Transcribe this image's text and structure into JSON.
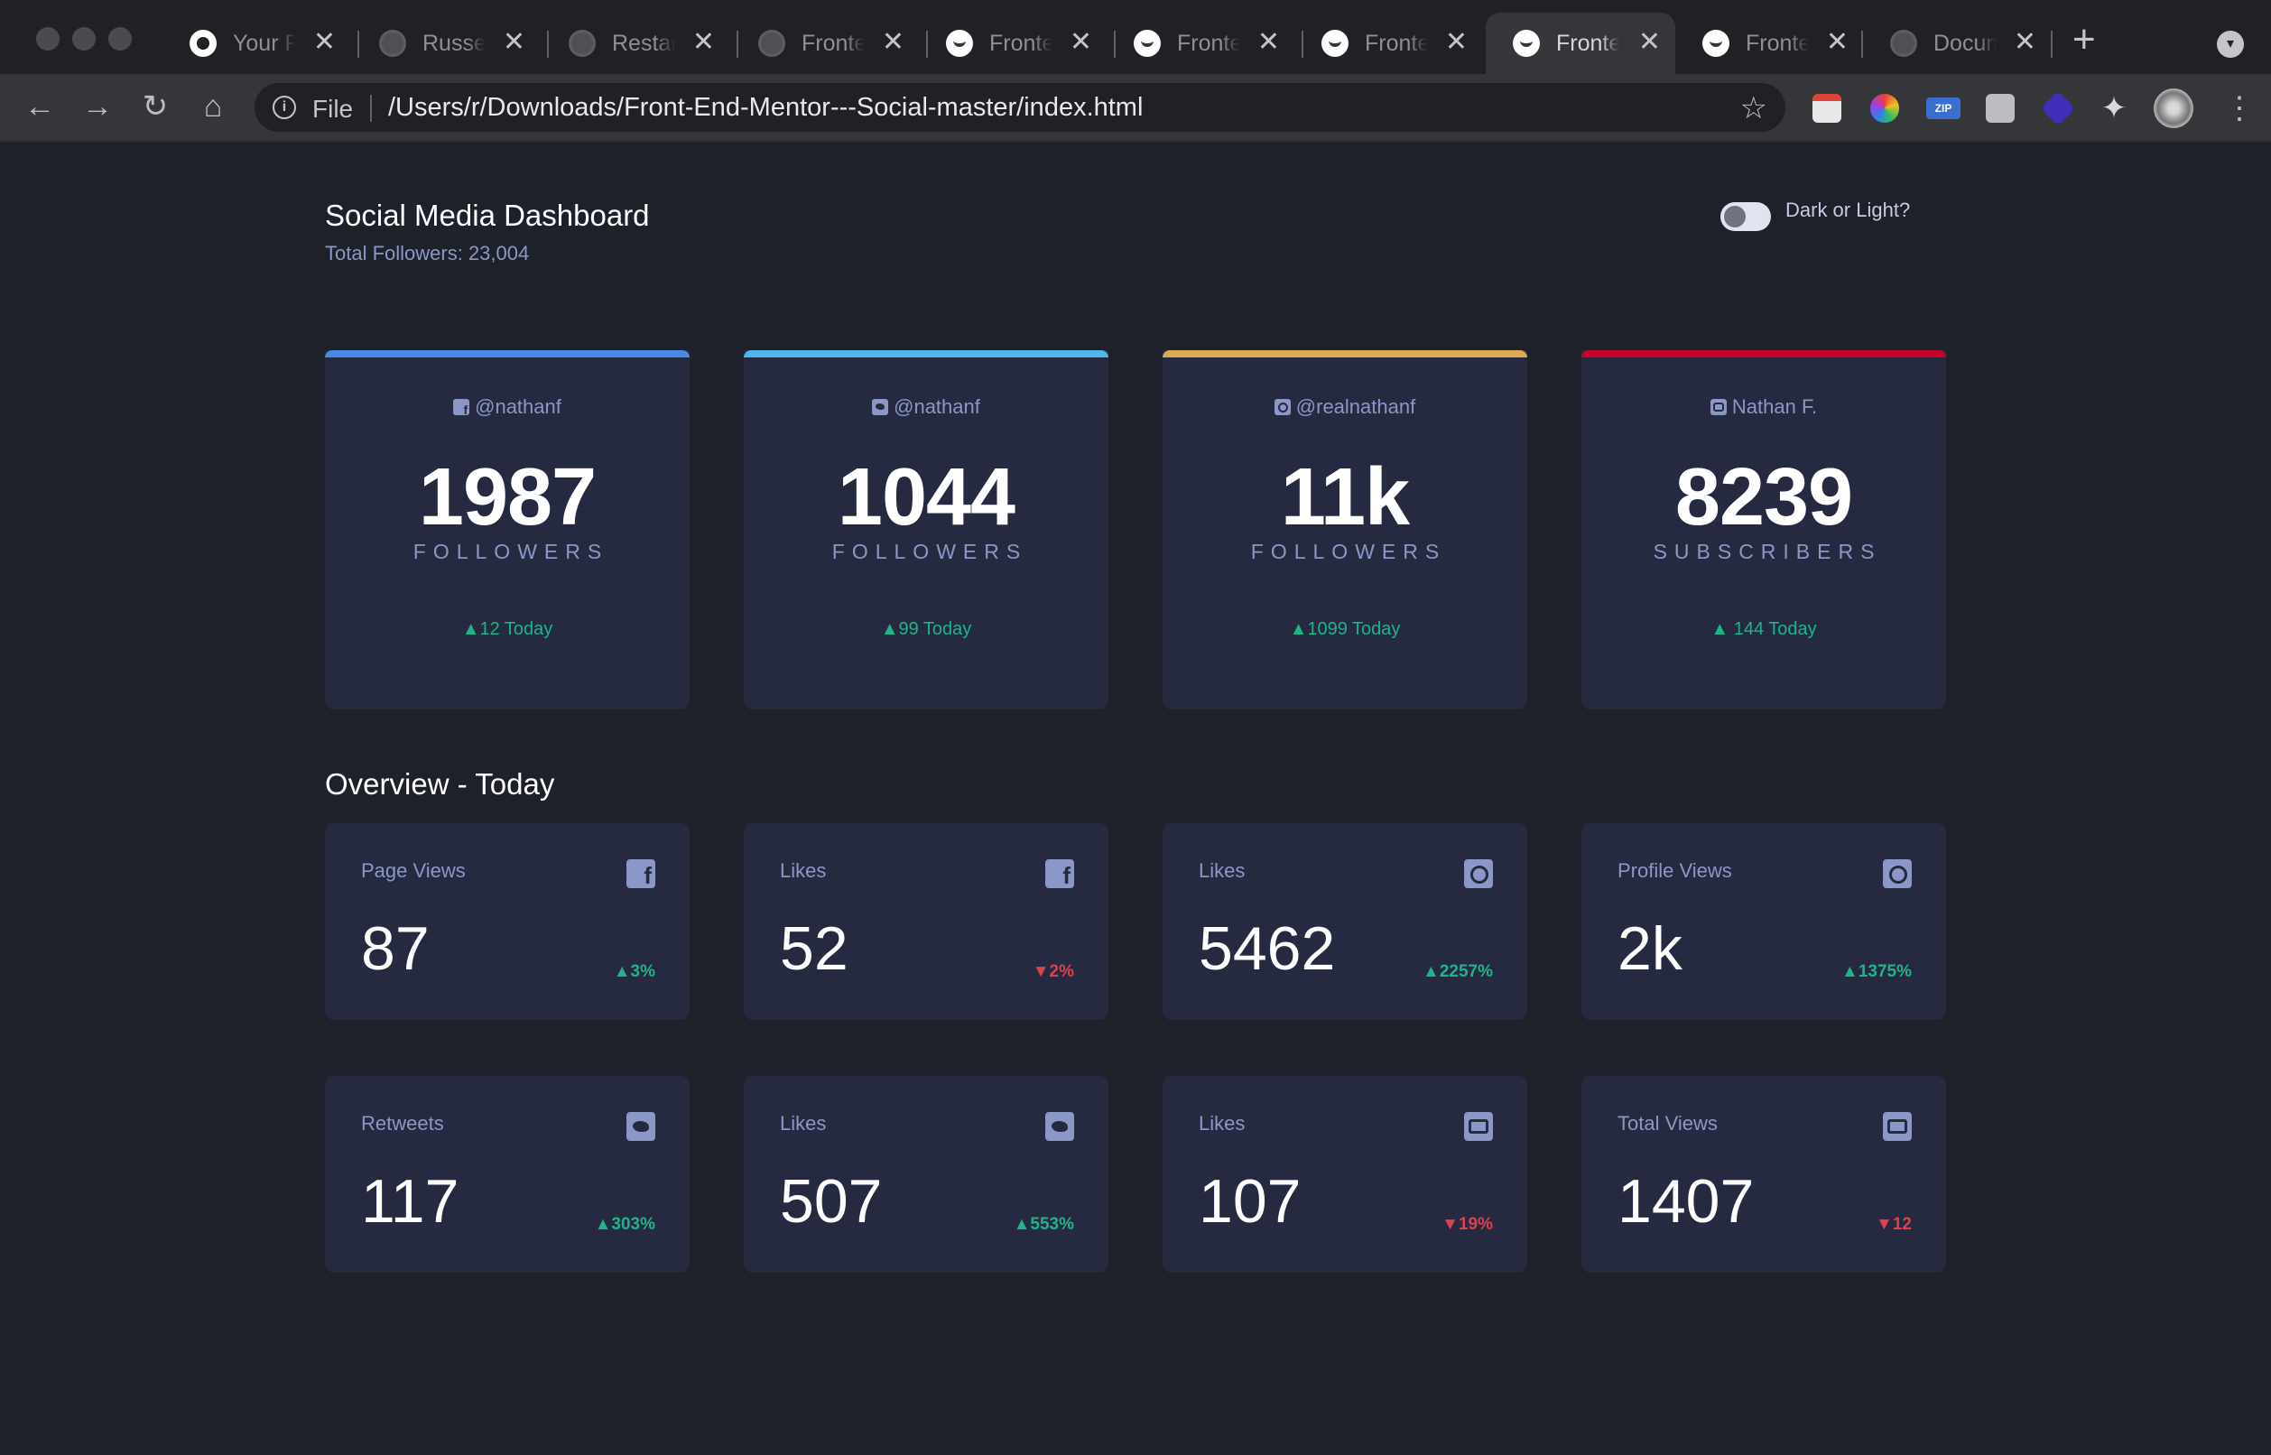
{
  "browser": {
    "tabs": [
      {
        "title": "Your Repositories",
        "icon": "github-icon",
        "active": false
      },
      {
        "title": "Russell",
        "icon": "globe-icon",
        "active": false
      },
      {
        "title": "Restaurant",
        "icon": "globe-icon",
        "active": false
      },
      {
        "title": "Frontend Mentor",
        "icon": "globe-icon",
        "active": false
      },
      {
        "title": "Frontend Mentor",
        "icon": "frontend-mentor-icon",
        "active": false
      },
      {
        "title": "Frontend Mentor",
        "icon": "frontend-mentor-icon",
        "active": false
      },
      {
        "title": "Frontend Mentor",
        "icon": "frontend-mentor-icon",
        "active": false
      },
      {
        "title": "Frontend Mentor",
        "icon": "frontend-mentor-icon",
        "active": true
      },
      {
        "title": "Frontend Mentor",
        "icon": "frontend-mentor-icon",
        "active": false
      },
      {
        "title": "Document",
        "icon": "globe-icon",
        "active": false
      }
    ],
    "tab_close_glyph": "✕",
    "new_tab_glyph": "+",
    "omnibox": {
      "scheme": "File",
      "url": "/Users/r/Downloads/Front-End-Mentor---Social-master/index.html"
    },
    "nav": {
      "back": "←",
      "forward": "→",
      "reload": "↻",
      "home": "⌂",
      "star": "☆",
      "menu": "⋮"
    },
    "extensions": [
      "calendar-extension-icon",
      "color-wheel-extension-icon",
      "zip-extension-icon",
      "camera-extension-icon",
      "layers-extension-icon",
      "puzzle-extension-icon"
    ],
    "extension_texts": {
      "zip": "ZIP",
      "puzzle": "✦"
    }
  },
  "header": {
    "title": "Social Media Dashboard",
    "subtitle": "Total Followers: 23,004",
    "toggle_label": "Dark or Light?"
  },
  "colors": {
    "background": "#1e202a",
    "card": "#252a41",
    "muted_text": "#8b97c6",
    "up": "#1eb589",
    "down": "#dc414c",
    "facebook": "#4b88e4",
    "twitter": "#4fb5ef",
    "instagram": "#dda954",
    "youtube": "#c4032a"
  },
  "followers": [
    {
      "network": "facebook",
      "icon": "facebook-icon",
      "handle": "@nathanf",
      "count": "1987",
      "unit": "FOLLOWERS",
      "delta": "▲12 Today",
      "trend": "up",
      "bar_color": "#4b88e4"
    },
    {
      "network": "twitter",
      "icon": "twitter-icon",
      "handle": "@nathanf",
      "count": "1044",
      "unit": "FOLLOWERS",
      "delta": "▲99 Today",
      "trend": "up",
      "bar_color": "#4fb5ef"
    },
    {
      "network": "instagram",
      "icon": "instagram-icon",
      "handle": "@realnathanf",
      "count": "11k",
      "unit": "FOLLOWERS",
      "delta": "▲1099 Today",
      "trend": "up",
      "bar_color": "#dda954"
    },
    {
      "network": "youtube",
      "icon": "youtube-icon",
      "handle": "Nathan F.",
      "count": "8239",
      "unit": "SUBSCRIBERS",
      "delta": "▲ 144 Today",
      "trend": "up",
      "bar_color": "#c4032a"
    }
  ],
  "overview": {
    "title": "Overview - Today",
    "cards": [
      {
        "label": "Page Views",
        "icon": "facebook-icon",
        "value": "87",
        "delta": "▲3%",
        "trend": "up"
      },
      {
        "label": "Likes",
        "icon": "facebook-icon",
        "value": "52",
        "delta": "▼2%",
        "trend": "down"
      },
      {
        "label": "Likes",
        "icon": "instagram-icon",
        "value": "5462",
        "delta": "▲2257%",
        "trend": "up"
      },
      {
        "label": "Profile Views",
        "icon": "instagram-icon",
        "value": "2k",
        "delta": "▲1375%",
        "trend": "up"
      },
      {
        "label": "Retweets",
        "icon": "twitter-icon",
        "value": "117",
        "delta": "▲303%",
        "trend": "up"
      },
      {
        "label": "Likes",
        "icon": "twitter-icon",
        "value": "507",
        "delta": "▲553%",
        "trend": "up"
      },
      {
        "label": "Likes",
        "icon": "youtube-icon",
        "value": "107",
        "delta": "▼19%",
        "trend": "down"
      },
      {
        "label": "Total Views",
        "icon": "youtube-icon",
        "value": "1407",
        "delta": "▼12",
        "trend": "down"
      }
    ]
  }
}
